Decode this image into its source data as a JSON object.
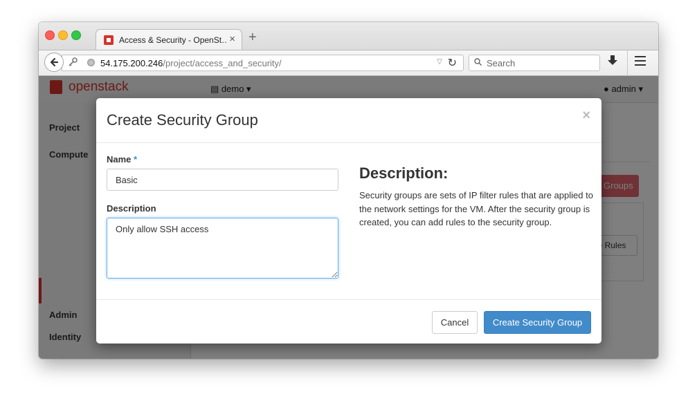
{
  "browser": {
    "tab_title": "Access & Security - OpenSt…",
    "tab_close": "×",
    "new_tab": "+",
    "url_host": "54.175.200.246",
    "url_path": "/project/access_and_security/",
    "search_placeholder": "Search"
  },
  "app": {
    "logo_text": "openstack",
    "project_menu": "demo",
    "user_menu": "admin",
    "sidebar": {
      "items": [
        {
          "label": "Project"
        },
        {
          "label": "Compute"
        },
        {
          "label": "Admin"
        },
        {
          "label": "Identity"
        }
      ]
    },
    "content": {
      "action_button_partial": "Groups",
      "row_button_partial": "ge Rules"
    }
  },
  "modal": {
    "title": "Create Security Group",
    "close": "×",
    "name_label": "Name",
    "required_marker": "*",
    "name_value": "Basic",
    "description_label": "Description",
    "description_value": "Only allow SSH access",
    "help_heading": "Description:",
    "help_text": "Security groups are sets of IP filter rules that are applied to the network settings for the VM. After the security group is created, you can add rules to the security group.",
    "cancel_label": "Cancel",
    "submit_label": "Create Security Group"
  },
  "colors": {
    "primary": "#428bca",
    "brand": "#d8322a",
    "danger": "#e0646d",
    "focus": "#66afe9"
  }
}
